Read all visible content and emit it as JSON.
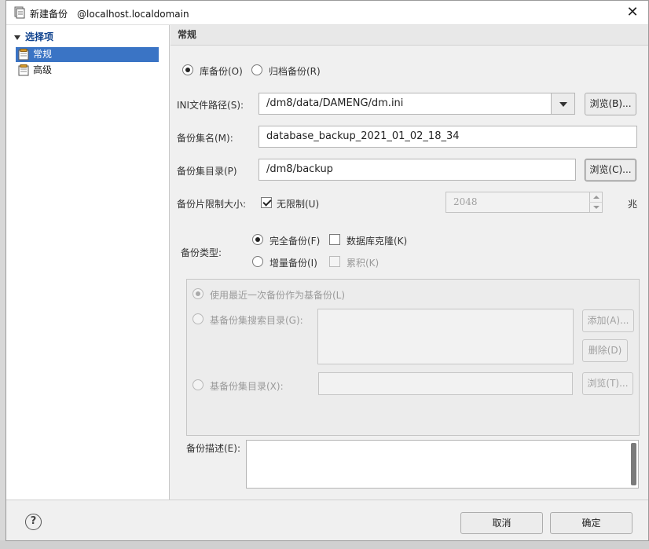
{
  "window": {
    "title": "新建备份",
    "host": "@localhost.localdomain",
    "icons": {
      "app": "backup-app-icon",
      "close": "close-icon"
    }
  },
  "tree": {
    "root_label": "选择项",
    "items": [
      {
        "label": "常规",
        "selected": true,
        "icon": "settings-page-icon"
      },
      {
        "label": "高级",
        "selected": false,
        "icon": "settings-page-icon"
      }
    ]
  },
  "section": {
    "title": "常规"
  },
  "backup_mode": {
    "options": [
      {
        "label": "库备份(O)",
        "checked": true
      },
      {
        "label": "归档备份(R)",
        "checked": false
      }
    ]
  },
  "ini_path": {
    "label": "INI文件路径(S):",
    "value": "/dm8/data/DAMENG/dm.ini",
    "browse_label": "浏览(B)..."
  },
  "backup_set_name": {
    "label": "备份集名(M):",
    "value": "database_backup_2021_01_02_18_34"
  },
  "backup_set_dir": {
    "label": "备份集目录(P)",
    "value": "/dm8/backup",
    "browse_label": "浏览(C)..."
  },
  "piece_limit": {
    "label": "备份片限制大小:",
    "checkbox_label": "无限制(U)",
    "unlimited": true,
    "size_value": "2048",
    "unit": "兆"
  },
  "backup_type": {
    "label": "备份类型:",
    "full_label": "完全备份(F)",
    "full_checked": true,
    "clone_label": "数据库克隆(K)",
    "clone_checked": false,
    "incremental_label": "增量备份(I)",
    "incremental_checked": false,
    "cumulative_label": "累积(K)",
    "cumulative_checked": false
  },
  "base_backup": {
    "use_latest_label": "使用最近一次备份作为基备份(L)",
    "search_dir_label": "基备份集搜索目录(G):",
    "add_label": "添加(A)...",
    "delete_label": "删除(D)",
    "base_dir_label": "基备份集目录(X):",
    "browse_label": "浏览(T)..."
  },
  "description": {
    "label": "备份描述(E):",
    "value": ""
  },
  "footer": {
    "cancel_label": "取消",
    "ok_label": "确定",
    "help_symbol": "?"
  }
}
